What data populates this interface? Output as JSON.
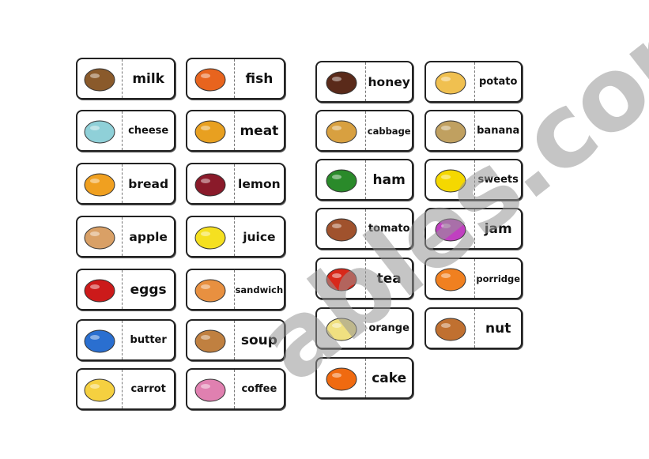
{
  "columns": [
    [
      {
        "picture": "walnut",
        "color": "#8a5a2b",
        "word": "milk"
      },
      {
        "picture": "milk-carton",
        "color": "#8fd0d8",
        "word": "cheese"
      },
      {
        "picture": "cheese",
        "color": "#f0a020",
        "word": "bread"
      },
      {
        "picture": "bread",
        "color": "#d9a066",
        "word": "apple"
      },
      {
        "picture": "apple",
        "color": "#cc1a1a",
        "word": "eggs"
      },
      {
        "picture": "eggs",
        "color": "#2a6fd0",
        "word": "butter"
      },
      {
        "picture": "butter",
        "color": "#f5d040",
        "word": "carrot"
      }
    ],
    [
      {
        "picture": "carrot",
        "color": "#e8641e",
        "word": "fish"
      },
      {
        "picture": "fish",
        "color": "#e8a020",
        "word": "meat"
      },
      {
        "picture": "meat",
        "color": "#8a1a2a",
        "word": "lemon"
      },
      {
        "picture": "lemon",
        "color": "#f5e020",
        "word": "juice"
      },
      {
        "picture": "juice",
        "color": "#e89040",
        "word": "sandwich"
      },
      {
        "picture": "sandwich",
        "color": "#c08040",
        "word": "soup"
      },
      {
        "picture": "soup",
        "color": "#e080b0",
        "word": "coffee"
      }
    ],
    [
      {
        "picture": "coffee",
        "color": "#5a2a1a",
        "word": "honey"
      },
      {
        "picture": "honey",
        "color": "#d8a040",
        "word": "cabbage"
      },
      {
        "picture": "cabbage",
        "color": "#2a8a2a",
        "word": "ham"
      },
      {
        "picture": "ham",
        "color": "#a0522d",
        "word": "tomato"
      },
      {
        "picture": "tomato",
        "color": "#d8281a",
        "word": "tea"
      },
      {
        "picture": "teapot",
        "color": "#f0e080",
        "word": "orange"
      },
      {
        "picture": "orange",
        "color": "#f06a10",
        "word": "cake"
      }
    ],
    [
      {
        "picture": "cake",
        "color": "#f0c050",
        "word": "potato"
      },
      {
        "picture": "potato",
        "color": "#c0a060",
        "word": "banana"
      },
      {
        "picture": "banana",
        "color": "#f5d800",
        "word": "sweets"
      },
      {
        "picture": "sweets",
        "color": "#c040c0",
        "word": "jam"
      },
      {
        "picture": "jam",
        "color": "#f08020",
        "word": "porridge"
      },
      {
        "picture": "porridge",
        "color": "#c07030",
        "word": "nut"
      }
    ]
  ],
  "watermark": "ables.com"
}
